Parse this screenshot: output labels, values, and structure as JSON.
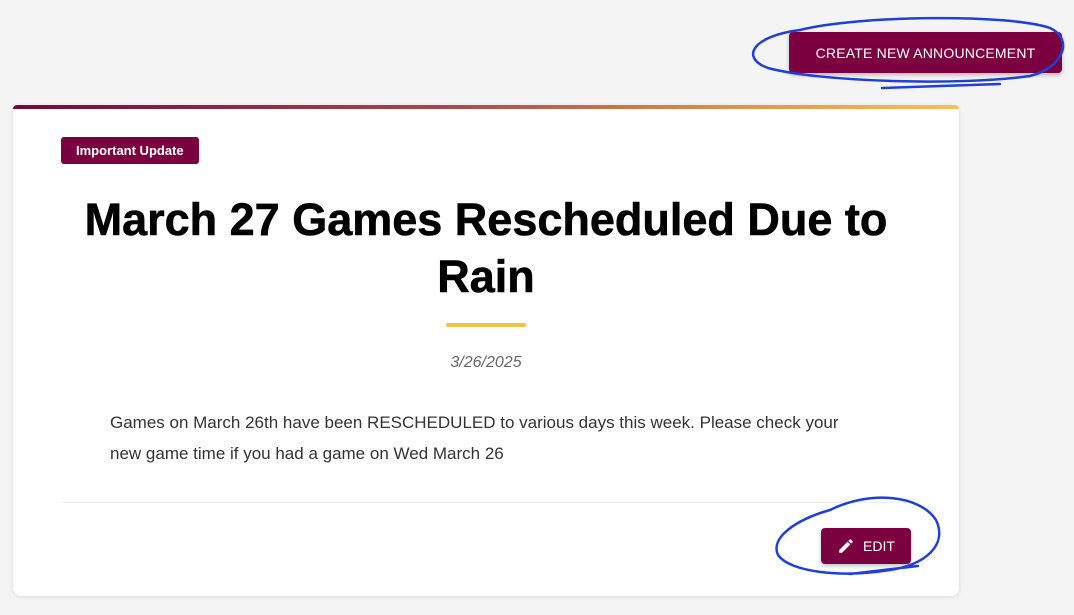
{
  "toolbar": {
    "create_label": "CREATE NEW ANNOUNCEMENT"
  },
  "announcement": {
    "badge": "Important Update",
    "title": "March 27 Games Rescheduled Due to Rain",
    "date": "3/26/2025",
    "body": "Games on March 26th have been RESCHEDULED to various days this week. Please check your new game time if you had a game on Wed March 26",
    "edit_label": "EDIT",
    "edit_icon": "pencil-icon"
  },
  "colors": {
    "brand": "#7b0040",
    "accent": "#f5c140",
    "annotation": "#1f3fd6"
  }
}
